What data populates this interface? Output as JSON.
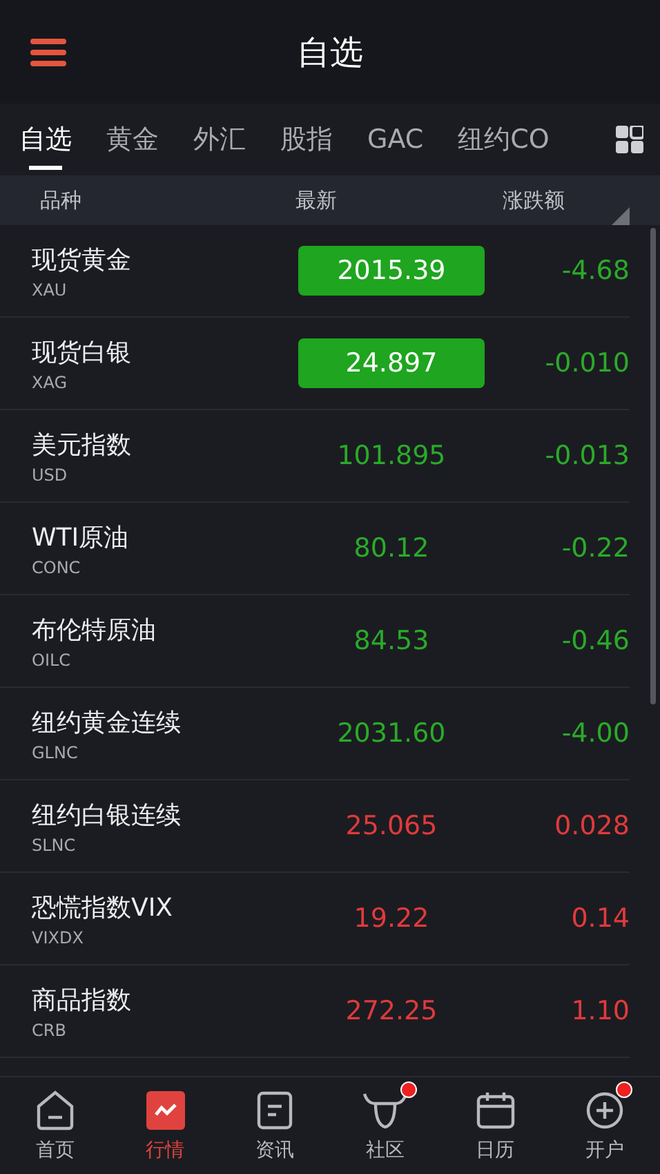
{
  "title": "自选",
  "tabs": [
    {
      "label": "自选",
      "selected": true
    },
    {
      "label": "黄金",
      "selected": false
    },
    {
      "label": "外汇",
      "selected": false
    },
    {
      "label": "股指",
      "selected": false
    },
    {
      "label": "GAC",
      "selected": false
    },
    {
      "label": "纽约CO",
      "selected": false
    }
  ],
  "columns": [
    "品种",
    "最新",
    "涨跌额"
  ],
  "rows": [
    {
      "name": "现货黄金",
      "code": "XAU",
      "price": "2015.39",
      "change": "-4.68",
      "rising": false,
      "flash": true
    },
    {
      "name": "现货白银",
      "code": "XAG",
      "price": "24.897",
      "change": "-0.010",
      "rising": false,
      "flash": true
    },
    {
      "name": "美元指数",
      "code": "USD",
      "price": "101.895",
      "change": "-0.013",
      "rising": false,
      "flash": false
    },
    {
      "name": "WTI原油",
      "code": "CONC",
      "price": "80.12",
      "change": "-0.22",
      "rising": false,
      "flash": false
    },
    {
      "name": "布伦特原油",
      "code": "OILC",
      "price": "84.53",
      "change": "-0.46",
      "rising": false,
      "flash": false
    },
    {
      "name": "纽约黄金连续",
      "code": "GLNC",
      "price": "2031.60",
      "change": "-4.00",
      "rising": false,
      "flash": false
    },
    {
      "name": "纽约白银连续",
      "code": "SLNC",
      "price": "25.065",
      "change": "0.028",
      "rising": true,
      "flash": false
    },
    {
      "name": "恐慌指数VIX",
      "code": "VIXDX",
      "price": "19.22",
      "change": "0.14",
      "rising": true,
      "flash": false
    },
    {
      "name": "商品指数",
      "code": "CRB",
      "price": "272.25",
      "change": "1.10",
      "rising": true,
      "flash": false
    }
  ],
  "nav": [
    {
      "kind": "home",
      "label": "首页",
      "selected": false,
      "badge": false
    },
    {
      "kind": "market",
      "label": "行情",
      "selected": true,
      "badge": false
    },
    {
      "kind": "news",
      "label": "资讯",
      "selected": false,
      "badge": false
    },
    {
      "kind": "community",
      "label": "社区",
      "selected": false,
      "badge": true
    },
    {
      "kind": "calendar",
      "label": "日历",
      "selected": false,
      "badge": false
    },
    {
      "kind": "account",
      "label": "开户",
      "selected": false,
      "badge": true
    }
  ]
}
